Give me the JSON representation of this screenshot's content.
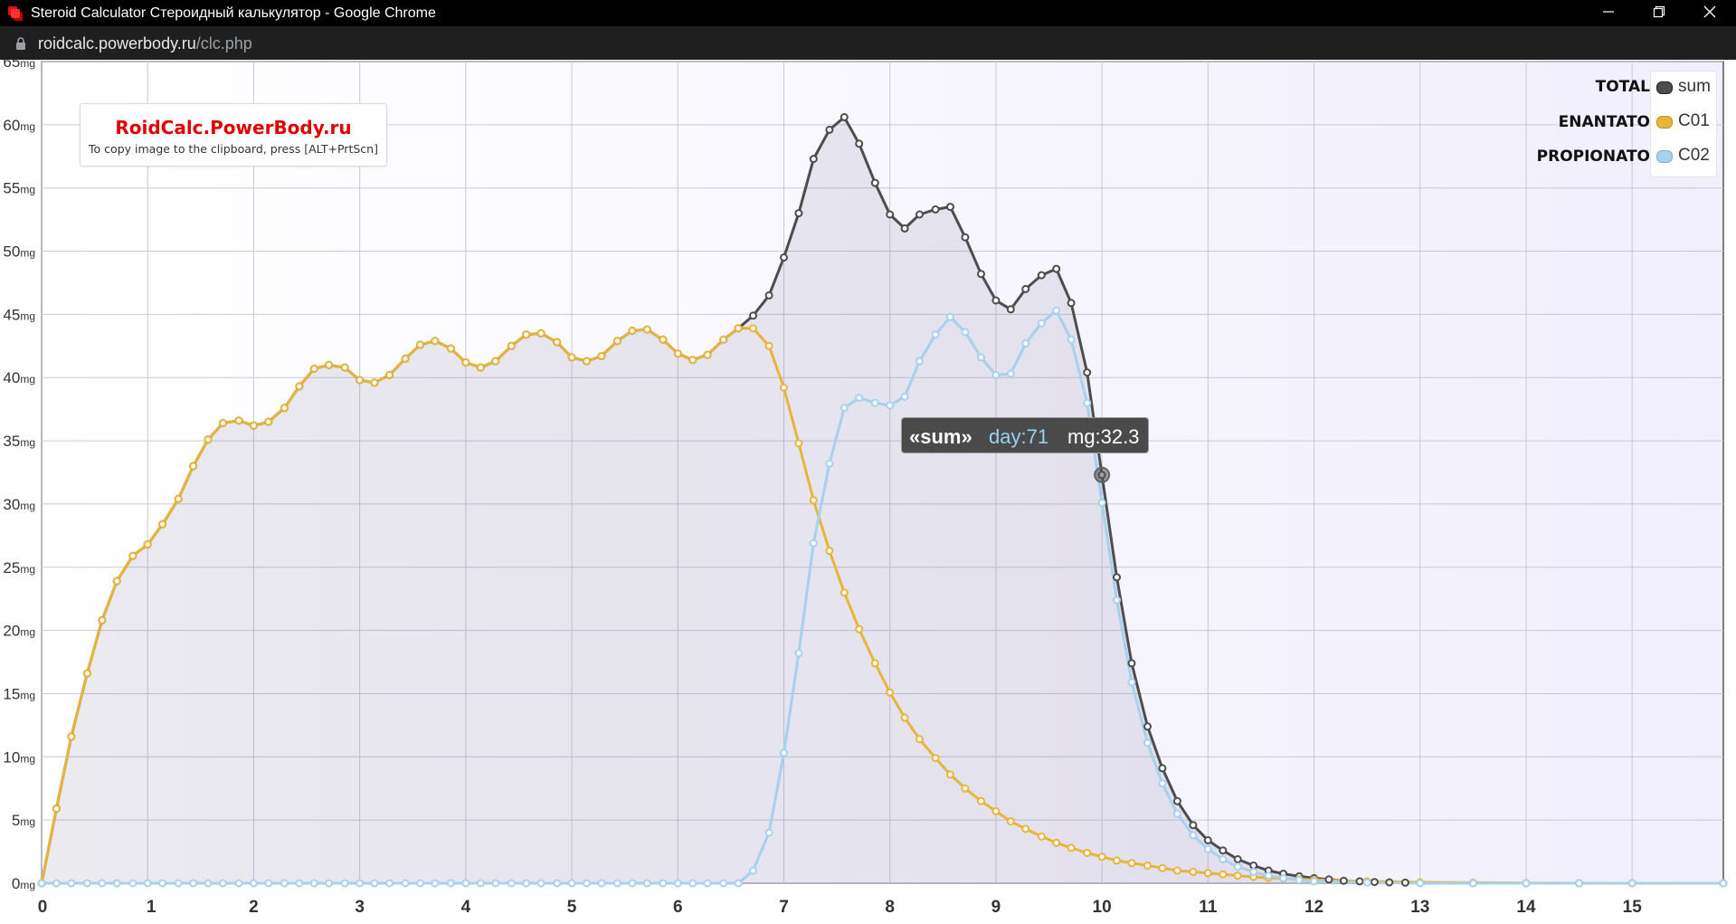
{
  "window": {
    "title": "Steroid Calculator Стероидный калькулятор - Google Chrome",
    "minimize_icon": "minimize-icon",
    "restore_icon": "restore-icon",
    "close_icon": "close-icon"
  },
  "address": {
    "domain": "roidcalc.powerbody.ru",
    "path": "/clc.php"
  },
  "notice": {
    "brand": "RoidCalc.PowerBody.ru",
    "hint": "To copy image to the clipboard, press [ALT+PrtScn]"
  },
  "legend": [
    {
      "name": "TOTAL",
      "label": "sum",
      "color": "#4d4d4d"
    },
    {
      "name": "ENANTATO",
      "label": "C01",
      "color": "#e8b53a"
    },
    {
      "name": "PROPIONATO",
      "label": "C02",
      "color": "#a9d0ec"
    }
  ],
  "tooltip": {
    "series": "«sum»",
    "day": "day:71",
    "mg": "mg:32.3"
  },
  "chart_data": {
    "type": "line",
    "xlabel": "",
    "ylabel": "",
    "x_unit": "week",
    "y_unit": "mg",
    "xlim": [
      0,
      15.86
    ],
    "ylim": [
      0,
      65
    ],
    "x_ticks": [
      "0",
      "1",
      "2",
      "3",
      "4",
      "5",
      "6",
      "7",
      "8",
      "9",
      "10",
      "11",
      "12",
      "13",
      "14",
      "15"
    ],
    "y_ticks": [
      "0mg",
      "5mg",
      "10mg",
      "15mg",
      "20mg",
      "25mg",
      "30mg",
      "35mg",
      "40mg",
      "45mg",
      "50mg",
      "55mg",
      "60mg",
      "65mg"
    ],
    "grid": true,
    "legend_position": "top-right",
    "series": [
      {
        "name": "sum",
        "color": "#4d4d4d",
        "points": [
          [
            0,
            0
          ],
          [
            0.14,
            5.9
          ],
          [
            0.28,
            11.6
          ],
          [
            0.43,
            16.6
          ],
          [
            0.57,
            20.8
          ],
          [
            0.71,
            23.9
          ],
          [
            0.86,
            25.9
          ],
          [
            1,
            26.8
          ],
          [
            1.14,
            28.4
          ],
          [
            1.29,
            30.4
          ],
          [
            1.43,
            33
          ],
          [
            1.57,
            35.1
          ],
          [
            1.71,
            36.4
          ],
          [
            1.86,
            36.6
          ],
          [
            2,
            36.2
          ],
          [
            2.14,
            36.5
          ],
          [
            2.29,
            37.6
          ],
          [
            2.43,
            39.3
          ],
          [
            2.57,
            40.7
          ],
          [
            2.71,
            41
          ],
          [
            2.86,
            40.8
          ],
          [
            3,
            39.8
          ],
          [
            3.14,
            39.6
          ],
          [
            3.28,
            40.2
          ],
          [
            3.43,
            41.5
          ],
          [
            3.57,
            42.6
          ],
          [
            3.71,
            42.9
          ],
          [
            3.86,
            42.3
          ],
          [
            4,
            41.2
          ],
          [
            4.14,
            40.8
          ],
          [
            4.28,
            41.3
          ],
          [
            4.43,
            42.5
          ],
          [
            4.57,
            43.4
          ],
          [
            4.71,
            43.5
          ],
          [
            4.86,
            42.8
          ],
          [
            5,
            41.6
          ],
          [
            5.14,
            41.3
          ],
          [
            5.28,
            41.7
          ],
          [
            5.43,
            42.9
          ],
          [
            5.57,
            43.7
          ],
          [
            5.71,
            43.8
          ],
          [
            5.86,
            43
          ],
          [
            6,
            41.9
          ],
          [
            6.14,
            41.4
          ],
          [
            6.28,
            41.8
          ],
          [
            6.43,
            43
          ],
          [
            6.57,
            43.9
          ],
          [
            6.71,
            44.9
          ],
          [
            6.86,
            46.5
          ],
          [
            7,
            49.5
          ],
          [
            7.14,
            53
          ],
          [
            7.28,
            57.3
          ],
          [
            7.43,
            59.6
          ],
          [
            7.57,
            60.6
          ],
          [
            7.71,
            58.5
          ],
          [
            7.86,
            55.4
          ],
          [
            8,
            52.9
          ],
          [
            8.14,
            51.8
          ],
          [
            8.28,
            52.9
          ],
          [
            8.43,
            53.3
          ],
          [
            8.57,
            53.5
          ],
          [
            8.71,
            51.1
          ],
          [
            8.86,
            48.2
          ],
          [
            9,
            46.1
          ],
          [
            9.14,
            45.4
          ],
          [
            9.28,
            47
          ],
          [
            9.43,
            48.1
          ],
          [
            9.57,
            48.6
          ],
          [
            9.71,
            45.9
          ],
          [
            9.86,
            40.4
          ],
          [
            10,
            32.3
          ],
          [
            10.14,
            24.2
          ],
          [
            10.28,
            17.4
          ],
          [
            10.43,
            12.4
          ],
          [
            10.57,
            9.1
          ],
          [
            10.71,
            6.5
          ],
          [
            10.86,
            4.6
          ],
          [
            11,
            3.4
          ],
          [
            11.14,
            2.6
          ],
          [
            11.28,
            1.9
          ],
          [
            11.43,
            1.4
          ],
          [
            11.57,
            1
          ],
          [
            11.71,
            0.75
          ],
          [
            11.86,
            0.55
          ],
          [
            12,
            0.4
          ],
          [
            12.14,
            0.3
          ],
          [
            12.28,
            0.2
          ],
          [
            12.43,
            0.15
          ],
          [
            12.57,
            0.1
          ],
          [
            12.71,
            0.07
          ],
          [
            12.86,
            0.05
          ],
          [
            13,
            0.03
          ],
          [
            13.5,
            0.01
          ],
          [
            14,
            0
          ],
          [
            14.5,
            0
          ],
          [
            15,
            0
          ],
          [
            15.86,
            0
          ]
        ]
      },
      {
        "name": "C01",
        "color": "#e8b53a",
        "points": [
          [
            0,
            0
          ],
          [
            0.14,
            5.9
          ],
          [
            0.28,
            11.6
          ],
          [
            0.43,
            16.6
          ],
          [
            0.57,
            20.8
          ],
          [
            0.71,
            23.9
          ],
          [
            0.86,
            25.9
          ],
          [
            1,
            26.8
          ],
          [
            1.14,
            28.4
          ],
          [
            1.29,
            30.4
          ],
          [
            1.43,
            33
          ],
          [
            1.57,
            35.1
          ],
          [
            1.71,
            36.4
          ],
          [
            1.86,
            36.6
          ],
          [
            2,
            36.2
          ],
          [
            2.14,
            36.5
          ],
          [
            2.29,
            37.6
          ],
          [
            2.43,
            39.3
          ],
          [
            2.57,
            40.7
          ],
          [
            2.71,
            41
          ],
          [
            2.86,
            40.8
          ],
          [
            3,
            39.8
          ],
          [
            3.14,
            39.6
          ],
          [
            3.28,
            40.2
          ],
          [
            3.43,
            41.5
          ],
          [
            3.57,
            42.6
          ],
          [
            3.71,
            42.9
          ],
          [
            3.86,
            42.3
          ],
          [
            4,
            41.2
          ],
          [
            4.14,
            40.8
          ],
          [
            4.28,
            41.3
          ],
          [
            4.43,
            42.5
          ],
          [
            4.57,
            43.4
          ],
          [
            4.71,
            43.5
          ],
          [
            4.86,
            42.8
          ],
          [
            5,
            41.6
          ],
          [
            5.14,
            41.3
          ],
          [
            5.28,
            41.7
          ],
          [
            5.43,
            42.9
          ],
          [
            5.57,
            43.7
          ],
          [
            5.71,
            43.8
          ],
          [
            5.86,
            43
          ],
          [
            6,
            41.9
          ],
          [
            6.14,
            41.4
          ],
          [
            6.28,
            41.8
          ],
          [
            6.43,
            43
          ],
          [
            6.57,
            43.9
          ],
          [
            6.71,
            43.9
          ],
          [
            6.86,
            42.5
          ],
          [
            7,
            39.2
          ],
          [
            7.14,
            34.8
          ],
          [
            7.28,
            30.3
          ],
          [
            7.43,
            26.3
          ],
          [
            7.57,
            23
          ],
          [
            7.71,
            20.1
          ],
          [
            7.86,
            17.4
          ],
          [
            8,
            15.1
          ],
          [
            8.14,
            13.1
          ],
          [
            8.28,
            11.4
          ],
          [
            8.43,
            9.9
          ],
          [
            8.57,
            8.6
          ],
          [
            8.71,
            7.5
          ],
          [
            8.86,
            6.5
          ],
          [
            9,
            5.7
          ],
          [
            9.14,
            4.9
          ],
          [
            9.28,
            4.3
          ],
          [
            9.43,
            3.7
          ],
          [
            9.57,
            3.2
          ],
          [
            9.71,
            2.8
          ],
          [
            9.86,
            2.4
          ],
          [
            10,
            2.1
          ],
          [
            10.14,
            1.8
          ],
          [
            10.28,
            1.6
          ],
          [
            10.43,
            1.4
          ],
          [
            10.57,
            1.2
          ],
          [
            10.71,
            1
          ],
          [
            10.86,
            0.9
          ],
          [
            11,
            0.8
          ],
          [
            11.14,
            0.7
          ],
          [
            11.28,
            0.6
          ],
          [
            11.43,
            0.5
          ],
          [
            11.57,
            0.43
          ],
          [
            11.71,
            0.37
          ],
          [
            11.86,
            0.32
          ],
          [
            12,
            0.28
          ],
          [
            12.5,
            0.15
          ],
          [
            13,
            0.08
          ],
          [
            13.5,
            0.04
          ],
          [
            14,
            0.02
          ],
          [
            14.5,
            0.01
          ],
          [
            15,
            0
          ],
          [
            15.86,
            0
          ]
        ]
      },
      {
        "name": "C02",
        "color": "#a9d0ec",
        "points": [
          [
            0,
            0
          ],
          [
            0.14,
            0
          ],
          [
            0.28,
            0
          ],
          [
            0.43,
            0
          ],
          [
            0.57,
            0
          ],
          [
            0.71,
            0
          ],
          [
            0.86,
            0
          ],
          [
            1,
            0
          ],
          [
            1.14,
            0
          ],
          [
            1.29,
            0
          ],
          [
            1.43,
            0
          ],
          [
            1.57,
            0
          ],
          [
            1.71,
            0
          ],
          [
            1.86,
            0
          ],
          [
            2,
            0
          ],
          [
            2.14,
            0
          ],
          [
            2.29,
            0
          ],
          [
            2.43,
            0
          ],
          [
            2.57,
            0
          ],
          [
            2.71,
            0
          ],
          [
            2.86,
            0
          ],
          [
            3,
            0
          ],
          [
            3.14,
            0
          ],
          [
            3.28,
            0
          ],
          [
            3.43,
            0
          ],
          [
            3.57,
            0
          ],
          [
            3.71,
            0
          ],
          [
            3.86,
            0
          ],
          [
            4,
            0
          ],
          [
            4.14,
            0
          ],
          [
            4.28,
            0
          ],
          [
            4.43,
            0
          ],
          [
            4.57,
            0
          ],
          [
            4.71,
            0
          ],
          [
            4.86,
            0
          ],
          [
            5,
            0
          ],
          [
            5.14,
            0
          ],
          [
            5.28,
            0
          ],
          [
            5.43,
            0
          ],
          [
            5.57,
            0
          ],
          [
            5.71,
            0
          ],
          [
            5.86,
            0
          ],
          [
            6,
            0
          ],
          [
            6.14,
            0
          ],
          [
            6.28,
            0
          ],
          [
            6.43,
            0
          ],
          [
            6.57,
            0
          ],
          [
            6.71,
            1
          ],
          [
            6.86,
            4
          ],
          [
            7,
            10.3
          ],
          [
            7.14,
            18.2
          ],
          [
            7.28,
            26.9
          ],
          [
            7.43,
            33.2
          ],
          [
            7.57,
            37.6
          ],
          [
            7.71,
            38.4
          ],
          [
            7.86,
            38
          ],
          [
            8,
            37.8
          ],
          [
            8.14,
            38.5
          ],
          [
            8.28,
            41.3
          ],
          [
            8.43,
            43.4
          ],
          [
            8.57,
            44.8
          ],
          [
            8.71,
            43.6
          ],
          [
            8.86,
            41.6
          ],
          [
            9,
            40.2
          ],
          [
            9.14,
            40.3
          ],
          [
            9.28,
            42.7
          ],
          [
            9.43,
            44.3
          ],
          [
            9.57,
            45.3
          ],
          [
            9.71,
            43
          ],
          [
            9.86,
            38
          ],
          [
            10,
            30.1
          ],
          [
            10.14,
            22.4
          ],
          [
            10.28,
            15.9
          ],
          [
            10.43,
            11.1
          ],
          [
            10.57,
            7.9
          ],
          [
            10.71,
            5.5
          ],
          [
            10.86,
            3.8
          ],
          [
            11,
            2.7
          ],
          [
            11.14,
            1.9
          ],
          [
            11.28,
            1.3
          ],
          [
            11.43,
            0.9
          ],
          [
            11.57,
            0.6
          ],
          [
            11.71,
            0.4
          ],
          [
            11.86,
            0.25
          ],
          [
            12,
            0.15
          ],
          [
            12.5,
            0.05
          ],
          [
            13,
            0.01
          ],
          [
            13.5,
            0
          ],
          [
            14,
            0
          ],
          [
            14.5,
            0
          ],
          [
            15,
            0
          ],
          [
            15.86,
            0
          ]
        ]
      }
    ],
    "highlight": {
      "series": "sum",
      "x": 10,
      "y": 32.3
    }
  }
}
